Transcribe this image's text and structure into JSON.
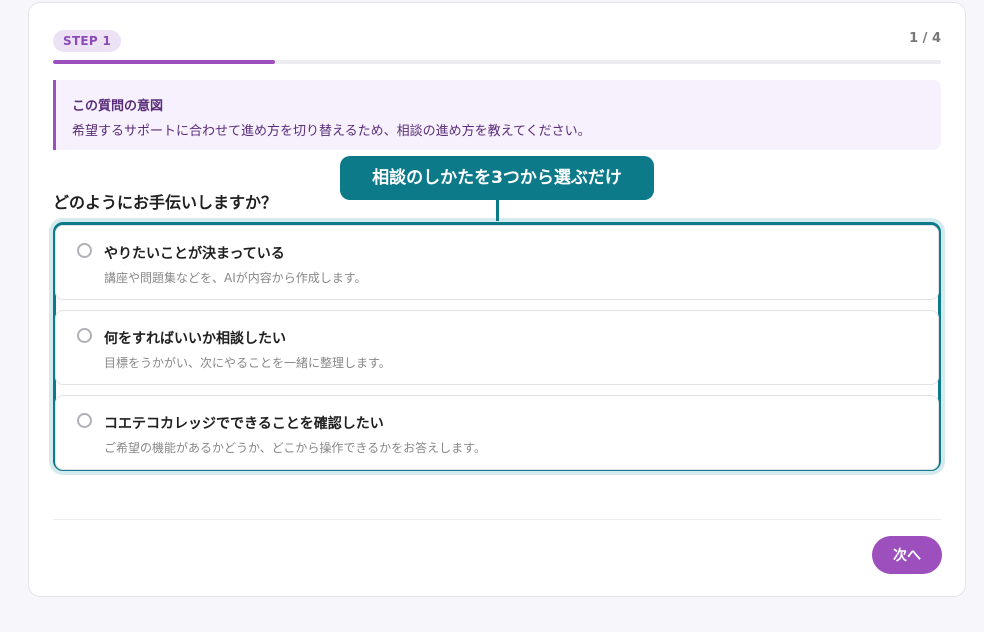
{
  "header": {
    "step_label": "STEP 1",
    "step_count": "1 / 4",
    "progress_fraction": 0.25
  },
  "purpose": {
    "title": "この質問の意図",
    "text": "希望するサポートに合わせて進め方を切り替えるため、相談の進め方を教えてください。"
  },
  "question": "どのようにお手伝いしますか？",
  "callout": "相談のしかたを3つから選ぶだけ",
  "options": [
    {
      "title": "やりたいことが決まっている",
      "description": "講座や問題集などを、AIが内容から作成します。"
    },
    {
      "title": "何をすればいいか相談したい",
      "description": "目標をうかがい、次にやることを一緒に整理します。"
    },
    {
      "title": "コエテコカレッジでできることを確認したい",
      "description": "ご希望の機能があるかどうか、どこから操作できるかをお答えします。"
    }
  ],
  "footer": {
    "next_label": "次へ"
  },
  "colors": {
    "accent": "#9c4fbd",
    "callout": "#0d7a8a"
  }
}
